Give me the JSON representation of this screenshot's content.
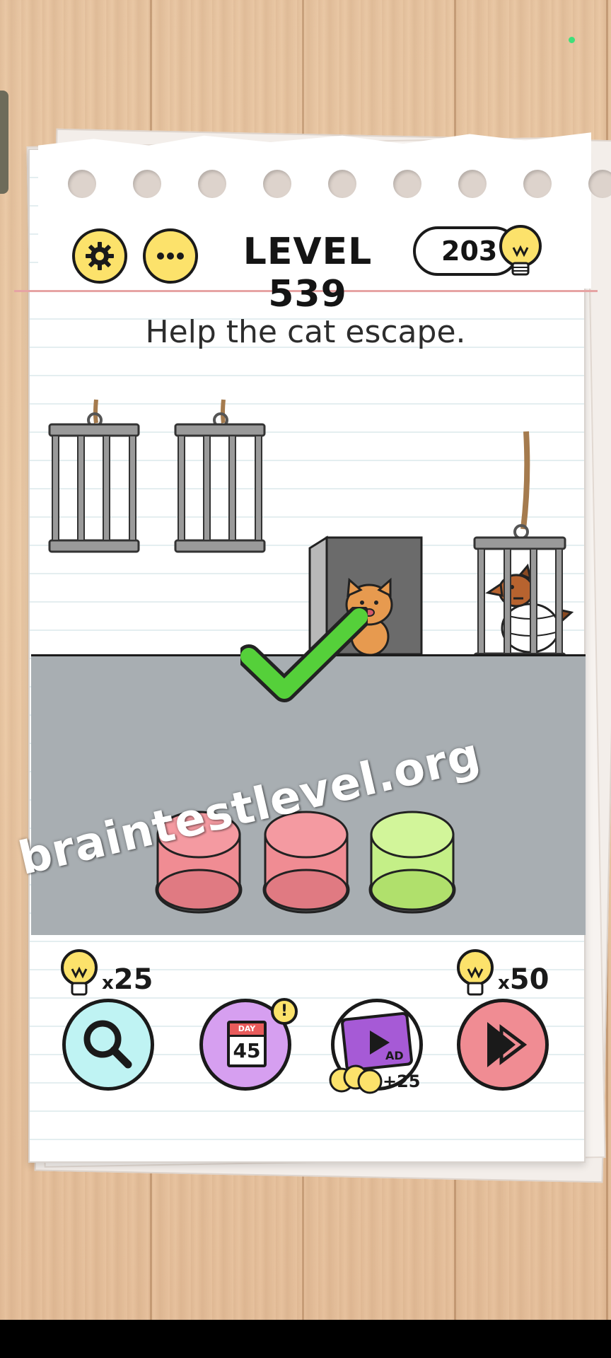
{
  "header": {
    "level_label": "LEVEL 539",
    "hint_count": "203"
  },
  "puzzle": {
    "question": "Help the cat escape."
  },
  "colors": {
    "button_red": "#f08c93",
    "button_green": "#c4ef87",
    "check_green": "#55d03a",
    "icon_yellow": "#fce26b"
  },
  "toolbar": {
    "hint_cost": "25",
    "hint_multiplier": "x",
    "skip_cost": "50",
    "skip_multiplier": "x",
    "daily_day_label": "DAY",
    "daily_day_number": "45",
    "daily_alert": "!",
    "video_ad_label": "AD",
    "video_reward": "+25"
  },
  "watermark": {
    "text": "braintestlevel.org"
  }
}
